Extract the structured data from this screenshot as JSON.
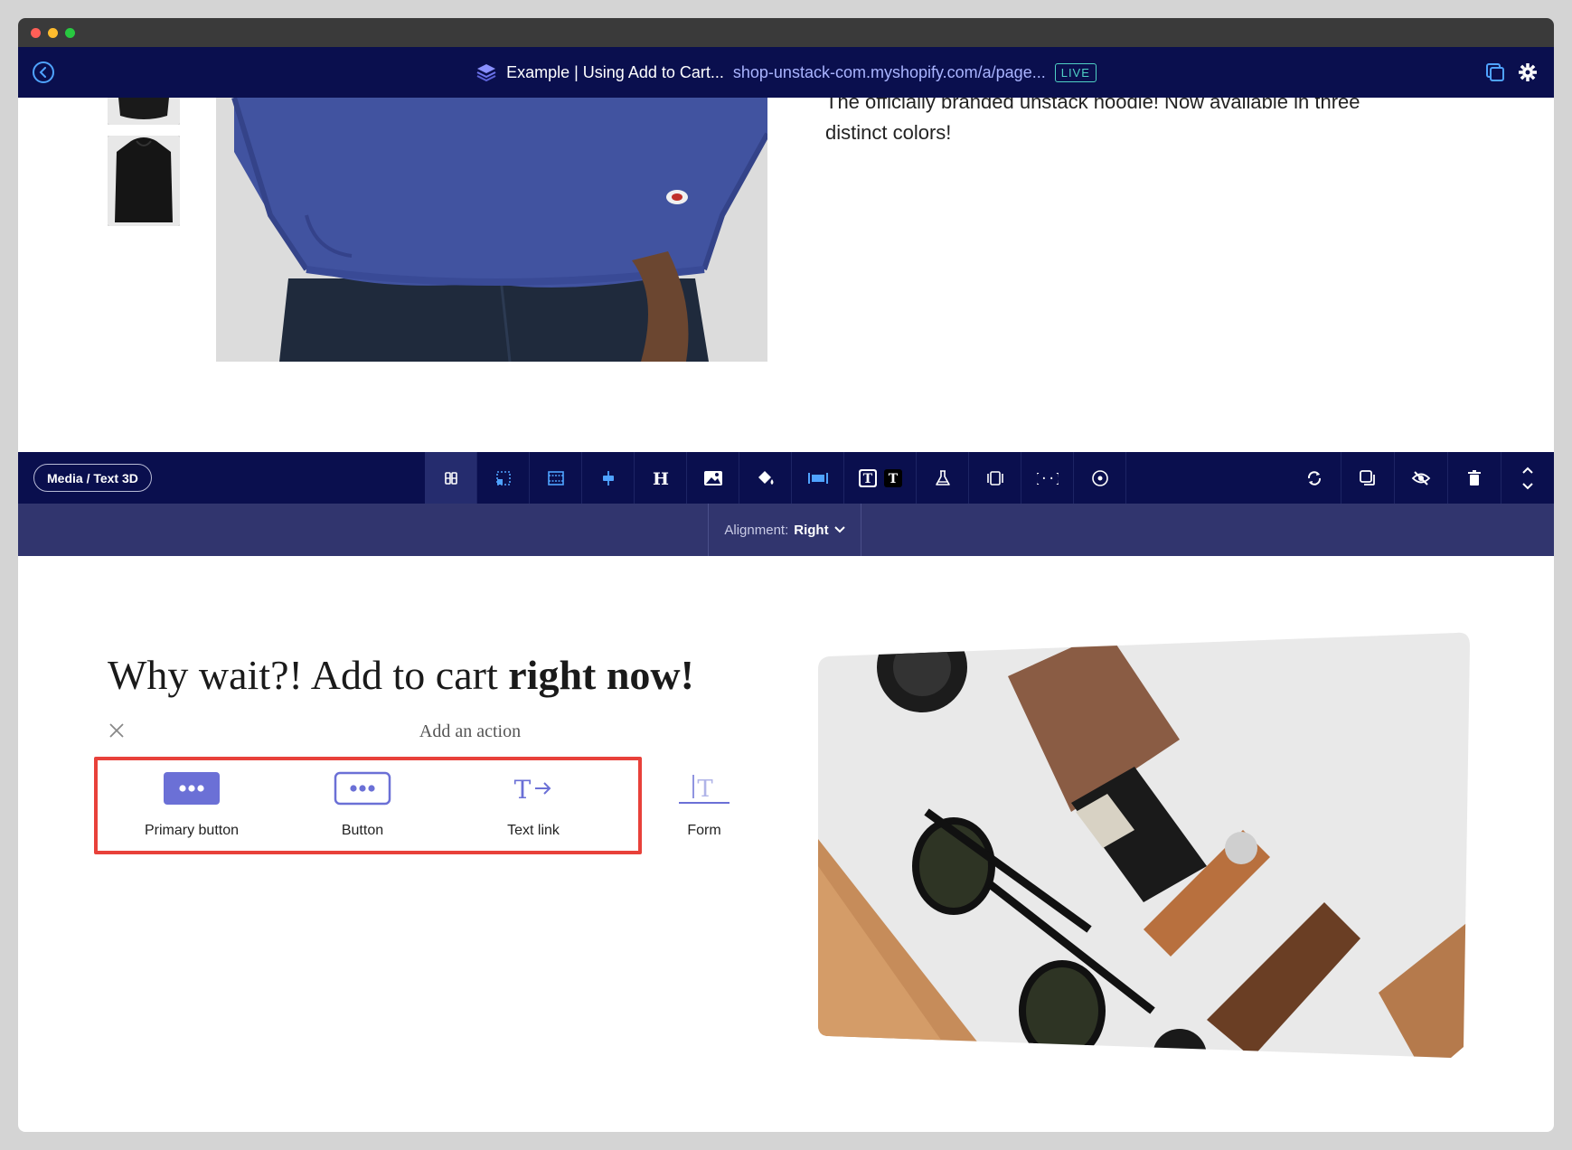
{
  "appbar": {
    "page_title": "Example | Using Add to Cart...",
    "page_url": "shop-unstack-com.myshopify.com/a/page...",
    "live_badge": "LIVE"
  },
  "product": {
    "description_line1": "The officially branded unstack hoodie! Now available in three",
    "description_line2": "distinct colors!"
  },
  "toolbar": {
    "block_name": "Media / Text 3D",
    "tools": [
      "layout-icon",
      "crop-icon",
      "section-icon",
      "align-icon",
      "heading-icon",
      "image-icon",
      "paint-bucket-icon",
      "width-icon",
      "text-style-icon",
      "flask-icon",
      "columns-icon",
      "code-icon",
      "target-icon"
    ],
    "right_tools": [
      "sync-icon",
      "duplicate-icon",
      "hide-icon",
      "trash-icon",
      "reorder-icon"
    ]
  },
  "subbar": {
    "alignment_label": "Alignment:",
    "alignment_value": "Right"
  },
  "content": {
    "headline_regular": "Why wait?! Add to cart ",
    "headline_bold": "right now!",
    "action_title": "Add an action",
    "actions": [
      {
        "label": "Primary button",
        "icon": "primary-button-icon"
      },
      {
        "label": "Button",
        "icon": "button-icon"
      },
      {
        "label": "Text link",
        "icon": "text-link-icon"
      },
      {
        "label": "Form",
        "icon": "form-icon"
      }
    ]
  },
  "colors": {
    "appbar_bg": "#0a0f4e",
    "subbar_bg": "#31356e",
    "accent": "#6b70d6",
    "highlight": "#e8413a",
    "live": "#4fd1c5"
  }
}
